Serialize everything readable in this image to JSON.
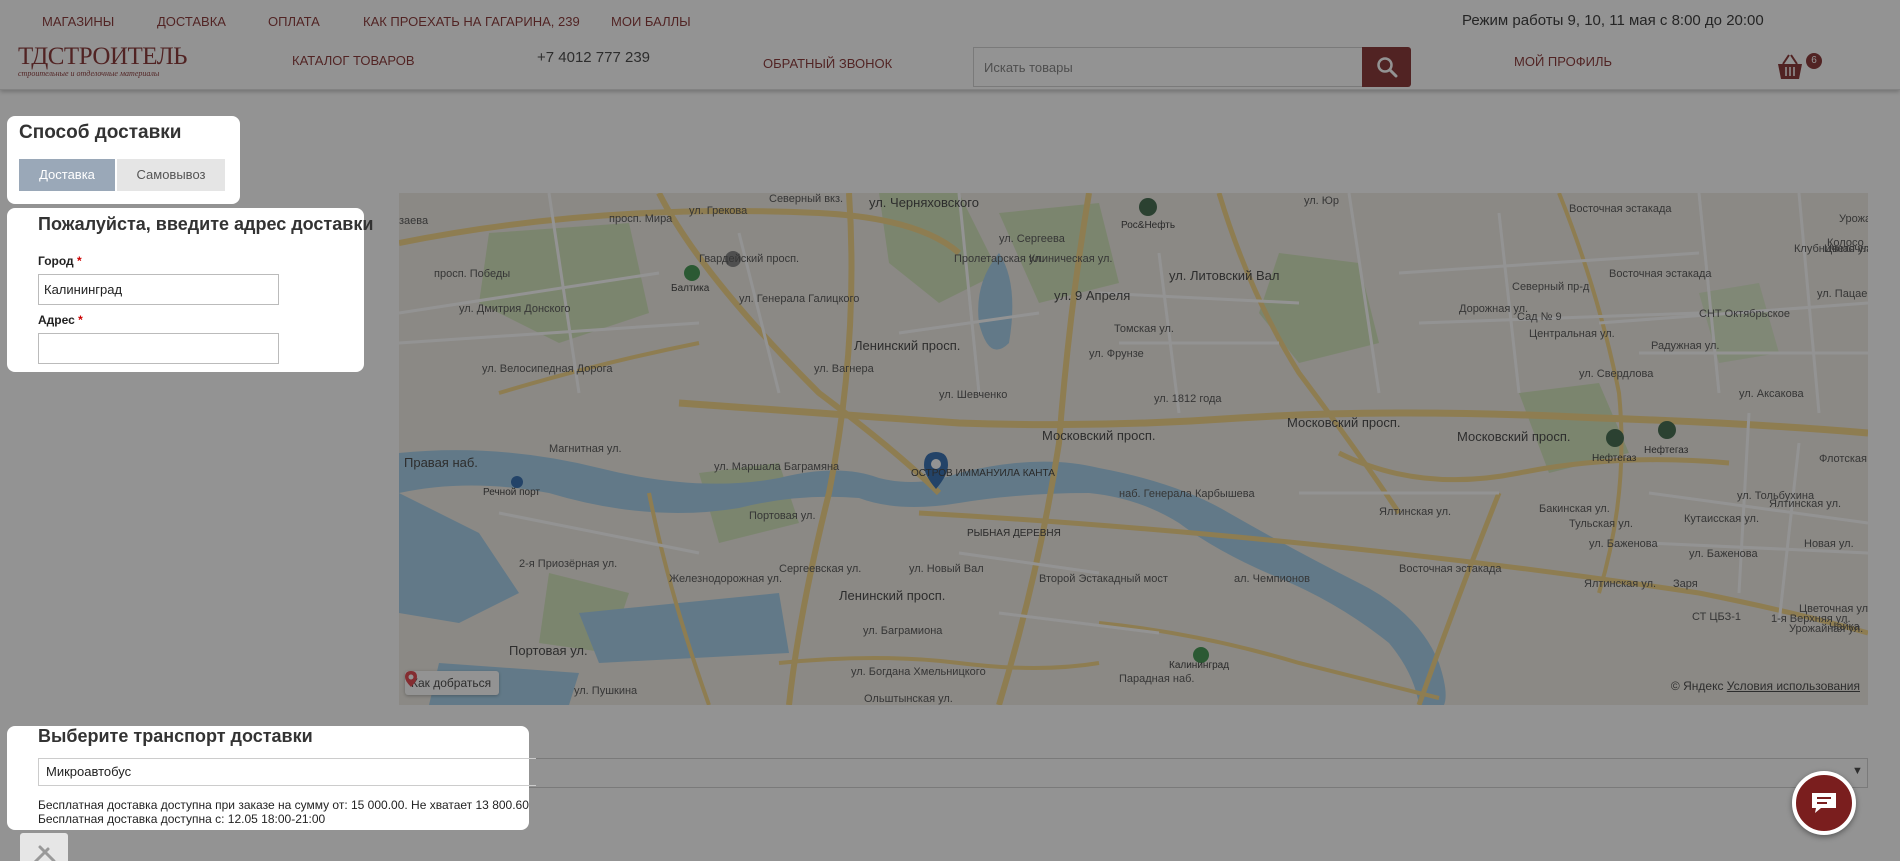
{
  "header": {
    "top_links": [
      "МАГАЗИНЫ",
      "ДОСТАВКА",
      "ОПЛАТА",
      "КАК ПРОЕХАТЬ НА ГАГАРИНА, 239",
      "МОИ БАЛЛЫ"
    ],
    "hours": "Режим работы 9, 10, 11 мая с 8:00 до 20:00",
    "logo_title": "ТДСТРОИТЕЛЬ",
    "logo_subtitle": "строительные и отделочные материалы",
    "catalog": "КАТАЛОГ ТОВАРОВ",
    "phone": "+7 4012 777 239",
    "callback": "ОБРАТНЫЙ ЗВОНОК",
    "search_placeholder": "Искать товары",
    "profile": "МОЙ ПРОФИЛЬ",
    "cart_count": "6",
    "accent_color": "#7a1e1e"
  },
  "delivery_method": {
    "title": "Способ доставки",
    "tabs": [
      {
        "label": "Доставка",
        "active": true
      },
      {
        "label": "Самовывоз",
        "active": false
      }
    ]
  },
  "address_form": {
    "title": "Пожалуйста, введите адрес доставки",
    "city_label": "Город",
    "city_value": "Калининград",
    "address_label": "Адрес",
    "address_value": "",
    "required_mark": "*"
  },
  "map": {
    "route_button": "Как добраться",
    "copyright": "© Яндекс",
    "terms": "Условия использования",
    "labels": [
      "Северный вкз.",
      "просп. Мира",
      "ул. Грекова",
      "ул. Черняховского",
      "Рос&Нефть",
      "ул. Юр",
      "Восточная эстакада",
      "Клубничная ул.",
      "Цветочная ул.",
      "Колосо",
      "Урожай",
      "заева",
      "просп. Победы",
      "Балтика",
      "Гвардейский просп.",
      "ул. Генерала Галицкого",
      "Пролетарская ул.",
      "ул. Сергеева",
      "Клиническая ул.",
      "ул. 9 Апреля",
      "ул. Литовский Вал",
      "Северный пр-д",
      "Восточная эстакада",
      "Сад № 9",
      "СНТ Октябрьское",
      "Центральная ул.",
      "Радужная ул.",
      "ул. Пацаева",
      "Дорожная ул.",
      "ул. Дмитрия Донского",
      "Ленинский просп.",
      "Томская ул.",
      "ул. Фрунзе",
      "ул. Вагнера",
      "ул. Велосипедная Дорога",
      "ул. Шевченко",
      "ул. 1812 года",
      "ул. Аксакова",
      "ул. Свердлова",
      "Московский просп.",
      "Московский просп.",
      "Московский просп.",
      "Нефтегаз",
      "Нефтегаз",
      "Правая наб.",
      "Речной порт",
      "Магнитная ул.",
      "ул. Маршала Баграмяна",
      "ОСТРОВ ИММАНУИЛА КАНТА",
      "наб. Генерала Карбышева",
      "Портовая ул.",
      "РЫБНАЯ ДЕРЕВНЯ",
      "Ялтинская ул.",
      "Ялтинская ул.",
      "Бакинская ул.",
      "Тульская ул.",
      "ул. Тольбухина",
      "Кутаисская ул.",
      "ул. Баженова",
      "ул. Баженова",
      "Флотская ул.",
      "Новая ул.",
      "Второй Эстакадный мост",
      "Железнодорожная ул.",
      "Ленинский просп.",
      "Сергеевская ул.",
      "ул. Новый Вал",
      "Восточная эстакада",
      "ал. Чемпионов",
      "Ялтинская ул.",
      "Заря",
      "СТ ЦБЗ-1",
      "1-я Верхняя ул.",
      "Урожайная ул.",
      "Цветочная ул.",
      "Чайка",
      "2-я Приозёрная ул.",
      "Портовая ул.",
      "ул. Баграмиона",
      "Калининград",
      "ул. Богдана Хмельницкого",
      "Парадная наб.",
      "ул. Пушкина",
      "Ольштынская ул."
    ]
  },
  "transport": {
    "title": "Выберите транспорт доставки",
    "selected": "Микроавтобус",
    "note1": "Бесплатная доставка доступна при заказе на сумму от: 15 000.00. Не хватает 13 800.60",
    "note2": "Бесплатная доставка доступна с: 12.05 18:00-21:00"
  }
}
